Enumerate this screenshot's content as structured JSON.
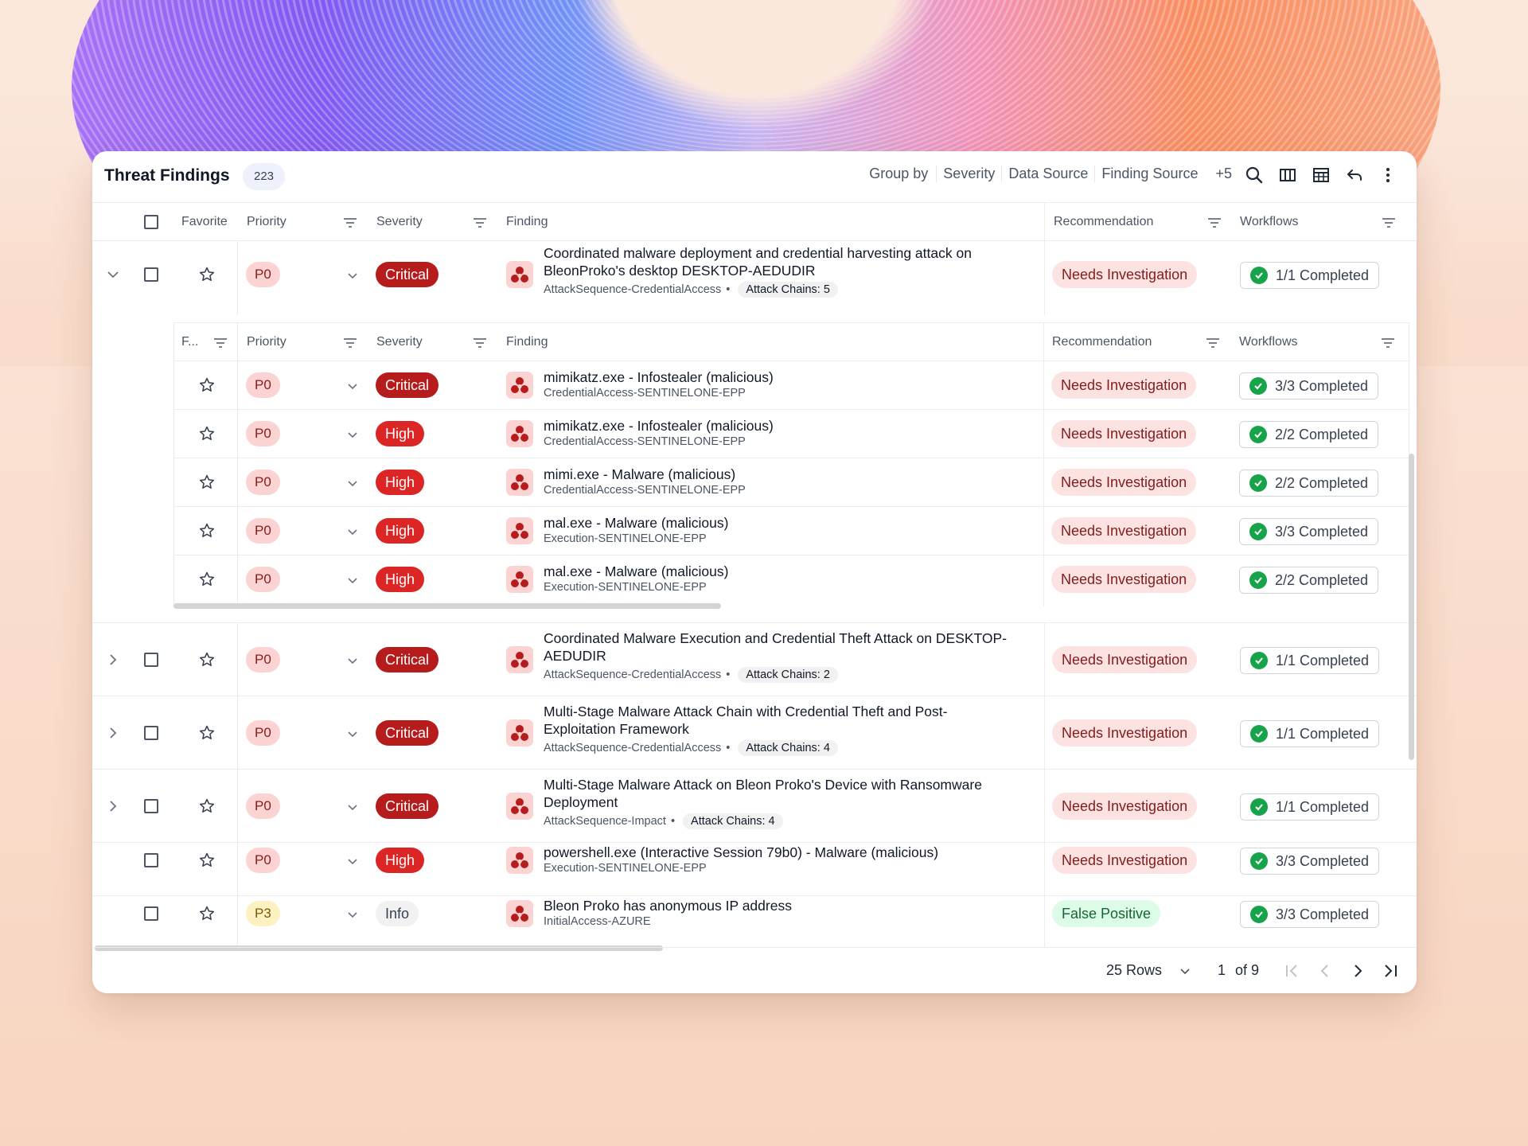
{
  "header": {
    "title": "Threat Findings",
    "count": "223",
    "group_by_label": "Group by",
    "group_by_options": [
      "Severity",
      "Data Source",
      "Finding Source"
    ],
    "group_by_more": "+5",
    "icons": [
      "search-icon",
      "columns-icon",
      "table-icon",
      "undo-icon",
      "more-vertical-icon"
    ]
  },
  "columns": {
    "favorite": "Favorite",
    "favorite_short": "F...",
    "priority": "Priority",
    "severity": "Severity",
    "finding": "Finding",
    "recommendation": "Recommendation",
    "workflows": "Workflows"
  },
  "rows": [
    {
      "priority": "P0",
      "severity": "Critical",
      "title_line1": "Coordinated malware deployment and credential harvesting attack on",
      "title_line2": "BleonProko's desktop DESKTOP-AEDUDIR",
      "source": "AttackSequence-CredentialAccess",
      "chains": "Attack Chains: 5",
      "recommendation": "Needs Investigation",
      "workflow": "1/1 Completed",
      "expanded": true
    },
    {
      "priority": "P0",
      "severity": "Critical",
      "title_line1": "Coordinated Malware Execution and Credential Theft Attack on DESKTOP-",
      "title_line2": "AEDUDIR",
      "source": "AttackSequence-CredentialAccess",
      "chains": "Attack Chains: 2",
      "recommendation": "Needs Investigation",
      "workflow": "1/1 Completed"
    },
    {
      "priority": "P0",
      "severity": "Critical",
      "title_line1": "Multi-Stage Malware Attack Chain with Credential Theft and Post-",
      "title_line2": "Exploitation Framework",
      "source": "AttackSequence-CredentialAccess",
      "chains": "Attack Chains: 4",
      "recommendation": "Needs Investigation",
      "workflow": "1/1 Completed"
    },
    {
      "priority": "P0",
      "severity": "Critical",
      "title_line1": "Multi-Stage Malware Attack on Bleon Proko's Device with Ransomware",
      "title_line2": "Deployment",
      "source": "AttackSequence-Impact",
      "chains": "Attack Chains: 4",
      "recommendation": "Needs Investigation",
      "workflow": "1/1 Completed"
    },
    {
      "priority": "P0",
      "severity": "High",
      "title_line1": "powershell.exe (Interactive Session 79b0) - Malware (malicious)",
      "source": "Execution-SENTINELONE-EPP",
      "recommendation": "Needs Investigation",
      "workflow": "3/3 Completed"
    },
    {
      "priority": "P3",
      "severity": "Info",
      "title_line1": "Bleon Proko has anonymous IP address",
      "source": "InitialAccess-AZURE",
      "recommendation": "False Positive",
      "workflow": "3/3 Completed"
    }
  ],
  "subrows": [
    {
      "priority": "P0",
      "severity": "Critical",
      "title": "mimikatz.exe - Infostealer (malicious)",
      "source": "CredentialAccess-SENTINELONE-EPP",
      "recommendation": "Needs Investigation",
      "workflow": "3/3 Completed"
    },
    {
      "priority": "P0",
      "severity": "High",
      "title": "mimikatz.exe - Infostealer (malicious)",
      "source": "CredentialAccess-SENTINELONE-EPP",
      "recommendation": "Needs Investigation",
      "workflow": "2/2 Completed"
    },
    {
      "priority": "P0",
      "severity": "High",
      "title": "mimi.exe - Malware (malicious)",
      "source": "CredentialAccess-SENTINELONE-EPP",
      "recommendation": "Needs Investigation",
      "workflow": "2/2 Completed"
    },
    {
      "priority": "P0",
      "severity": "High",
      "title": "mal.exe - Malware (malicious)",
      "source": "Execution-SENTINELONE-EPP",
      "recommendation": "Needs Investigation",
      "workflow": "3/3 Completed"
    },
    {
      "priority": "P0",
      "severity": "High",
      "title": "mal.exe - Malware (malicious)",
      "source": "Execution-SENTINELONE-EPP",
      "recommendation": "Needs Investigation",
      "workflow": "2/2 Completed"
    }
  ],
  "footer": {
    "rows_per_page": "25 Rows",
    "page_current": "1",
    "page_of": "of 9"
  },
  "colors": {
    "critical": "#b71c1c",
    "high": "#dc2626",
    "priority_p0": "#fbd3d3",
    "priority_p3": "#fdf1c2",
    "needs_investigation": "#fde2e2",
    "false_positive": "#dcfce7",
    "completed_check": "#16a34a"
  }
}
